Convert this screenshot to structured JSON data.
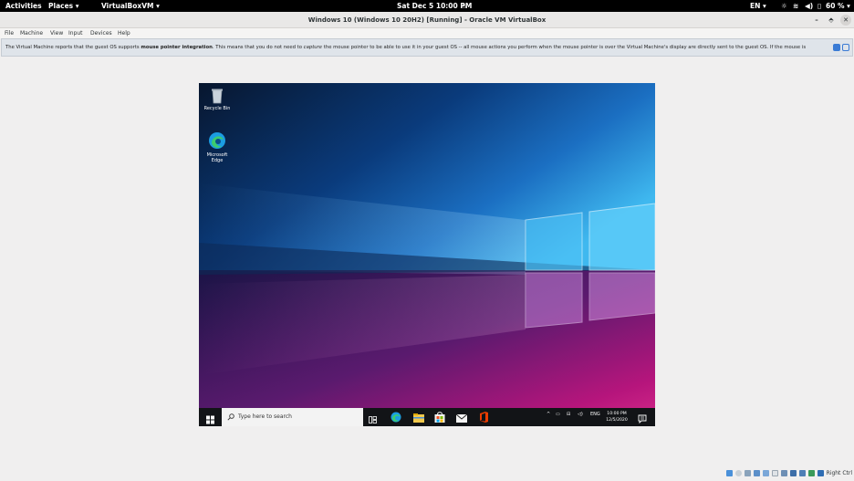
{
  "topbar": {
    "activities": "Activities",
    "places": "Places ▾",
    "app": "VirtualBoxVM ▾",
    "datetime": "Sat Dec 5  10:00 PM",
    "lang": "EN ▾",
    "battery": "60 % ▾"
  },
  "window": {
    "title": "Windows 10 (Windows 10 20H2) [Running] - Oracle VM VirtualBox"
  },
  "menu": {
    "items": [
      "File",
      "Machine",
      "View",
      "Input",
      "Devices",
      "Help"
    ]
  },
  "notice": {
    "part1": "The Virtual Machine reports that the guest OS supports ",
    "bold": "mouse pointer integration",
    "part2": ". This means that you do not need to ",
    "italic": "capture",
    "part3": " the mouse pointer to be able to use it in your guest OS -- all mouse actions you perform when the mouse pointer is over the Virtual Machine's display are directly sent to the guest OS. If the mouse is"
  },
  "desktop": {
    "recycle_bin": "Recycle Bin",
    "edge_line1": "Microsoft",
    "edge_line2": "Edge"
  },
  "taskbar": {
    "search_placeholder": "Type here to search",
    "lang": "ENG",
    "time": "10:00 PM",
    "date": "12/5/2020"
  },
  "statusbar": {
    "host_key": "Right Ctrl"
  },
  "colors": {
    "accent": "#3a7bd5",
    "taskbar": "#121417"
  }
}
